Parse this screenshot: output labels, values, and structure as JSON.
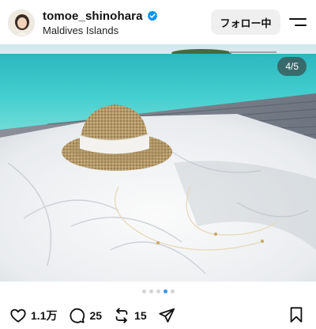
{
  "post": {
    "username": "tomoe_shinohara",
    "location": "Maldives Islands",
    "verified": true,
    "follow_label": "フォロー中",
    "image_counter": "4/5",
    "carousel": {
      "total": 5,
      "active_index": 3
    },
    "actions": {
      "likes": "1.1万",
      "comments": "25",
      "reposts": "15"
    },
    "icons": [
      "verified-badge-icon",
      "menu-icon",
      "heart-icon",
      "comment-icon",
      "repost-icon",
      "share-icon",
      "bookmark-icon"
    ],
    "colors": {
      "verified": "#0095f6",
      "active_dot": "#3897f0",
      "follow_bg": "#efefef"
    }
  }
}
